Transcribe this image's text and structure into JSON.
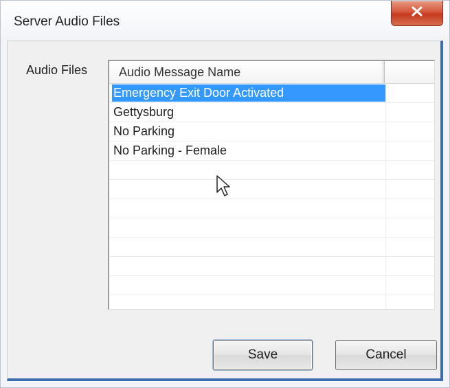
{
  "window": {
    "title": "Server Audio Files"
  },
  "icons": {
    "close": "close-x-icon",
    "pointer": "mouse-pointer-icon"
  },
  "group": {
    "label": "Audio Files"
  },
  "list": {
    "headers": [
      "Audio Message Name",
      ""
    ],
    "items": [
      {
        "name": "Emergency Exit Door Activated",
        "selected": true
      },
      {
        "name": "Gettysburg",
        "selected": false
      },
      {
        "name": "No Parking",
        "selected": false
      },
      {
        "name": "No Parking - Female",
        "selected": false
      }
    ],
    "selection_color": "#3399ff"
  },
  "buttons": {
    "save_label": "Save",
    "cancel_label": "Cancel"
  }
}
